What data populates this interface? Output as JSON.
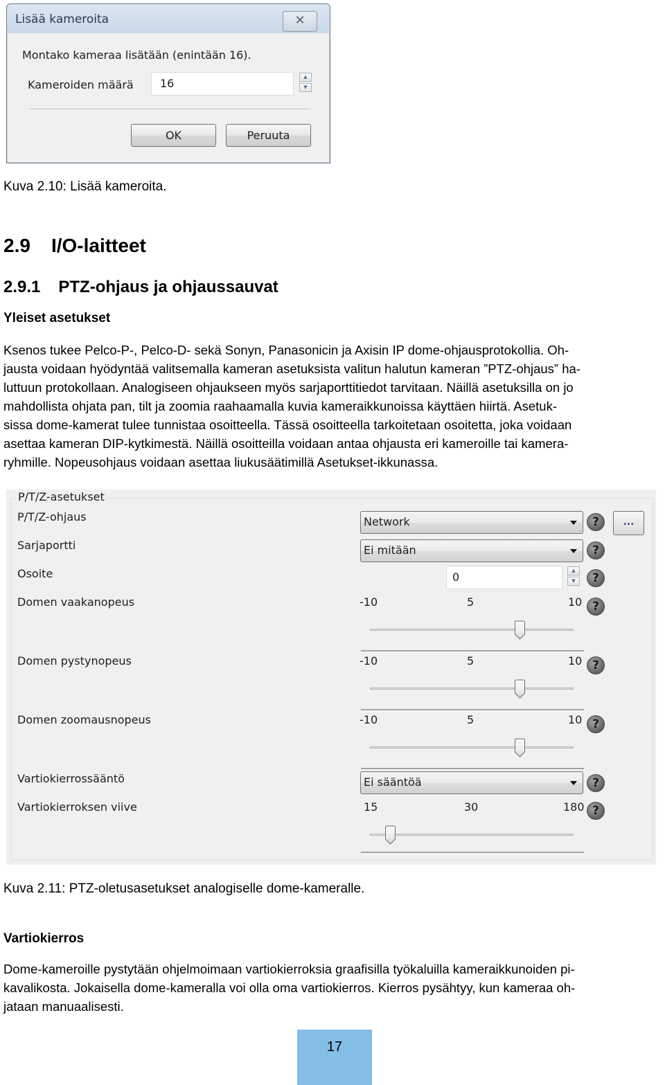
{
  "dialog": {
    "title": "Lisää kameroita",
    "close_label": "✕",
    "prompt": "Montako kameraa lisätään (enintään 16).",
    "count_label": "Kameroiden määrä",
    "count_value": "16",
    "spin_up": "▲",
    "spin_down": "▼",
    "ok_label": "OK",
    "cancel_label": "Peruuta"
  },
  "caption_1": "Kuva 2.10: Lisää kameroita.",
  "section": {
    "number": "2.9",
    "title": "I/O-laitteet"
  },
  "subsection": {
    "number": "2.9.1",
    "title": "PTZ-ohjaus ja ohjaussauvat"
  },
  "heading_general": "Yleiset asetukset",
  "paragraph_1": [
    "Ksenos tukee Pelco-P-, Pelco-D- sekä Sonyn, Panasonicin ja Axisin IP dome-ohjausprotokollia. Oh-",
    "jausta voidaan hyödyntää valitsemalla kameran asetuksista valitun halutun kameran ”PTZ-ohjaus” ha-",
    "luttuun protokollaan. Analogiseen ohjaukseen myös sarjaporttitiedot tarvitaan. Näillä asetuksilla on jo",
    "mahdollista ohjata pan, tilt ja zoomia raahaamalla kuvia kameraikkunoissa käyttäen hiirtä. Asetuk-",
    "sissa dome-kamerat tulee tunnistaa osoitteella. Tässä osoitteella tarkoitetaan osoitetta, joka voidaan",
    "asettaa kameran DIP-kytkimestä. Näillä osoitteilla voidaan antaa ohjausta eri kameroille tai kamera-",
    "ryhmille. Nopeusohjaus voidaan asettaa liukusäätimillä Asetukset-ikkunassa."
  ],
  "ptz_panel": {
    "group_title": "P/T/Z-asetukset",
    "help_glyph": "?",
    "more_button": "...",
    "control": {
      "label": "P/T/Z-ohjaus",
      "value": "Network"
    },
    "serial_port": {
      "label": "Sarjaportti",
      "value": "Ei mitään"
    },
    "address": {
      "label": "Osoite",
      "value": "0"
    },
    "pan_speed": {
      "label": "Domen vaakanopeus",
      "min": "-10",
      "mid": "5",
      "max": "10",
      "value": 5
    },
    "tilt_speed": {
      "label": "Domen pystynopeus",
      "min": "-10",
      "mid": "5",
      "max": "10",
      "value": 5
    },
    "zoom_speed": {
      "label": "Domen zoomausnopeus",
      "min": "-10",
      "mid": "5",
      "max": "10",
      "value": 5
    },
    "patrol_rule": {
      "label": "Vartiokierrossääntö",
      "value": "Ei sääntöä"
    },
    "patrol_delay": {
      "label": "Vartiokierroksen viive",
      "min": "15",
      "mid": "30",
      "max": "180",
      "value": 30
    }
  },
  "caption_2": "Kuva 2.11: PTZ-oletusasetukset analogiselle dome-kameralle.",
  "heading_patrol": "Vartiokierros",
  "paragraph_2": [
    "Dome-kameroille pystytään ohjelmoimaan vartiokierroksia graafisilla työkaluilla kameraikkunoiden pi-",
    "kavalikosta. Jokaisella dome-kameralla voi olla oma vartiokierros. Kierros pysähtyy, kun kameraa oh-",
    "jataan manuaalisesti."
  ],
  "page_number": "17"
}
